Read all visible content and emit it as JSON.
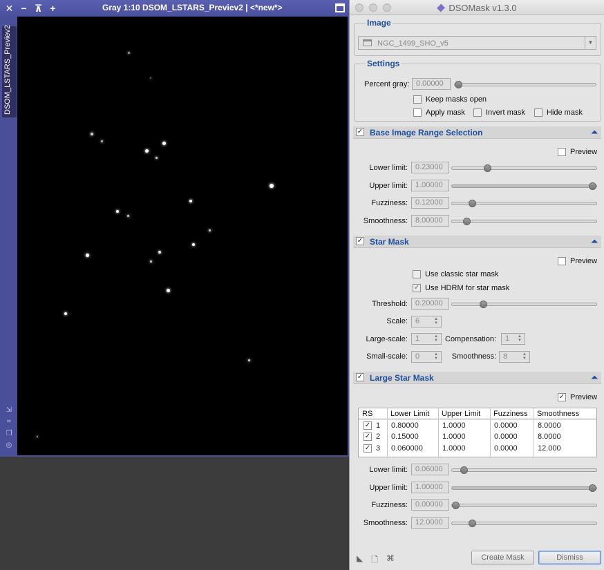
{
  "image_window": {
    "title": "Gray 1:10 DSOM_LSTARS_Previev2 | <*new*>",
    "side_tab": "DSOM_LSTARS_Previev2",
    "controls": [
      "✕",
      "−",
      "⊼",
      "+"
    ]
  },
  "dialog": {
    "title": "DSOMask v1.3.0",
    "image_group": {
      "title": "Image",
      "selected_image": "NGC_1499_SHO_v5"
    },
    "settings_group": {
      "title": "Settings",
      "percent_gray_label": "Percent gray:",
      "percent_gray_value": "0.00000",
      "percent_gray_level": 0.0,
      "keep_masks_open_label": "Keep masks open",
      "apply_mask_label": "Apply mask",
      "invert_mask_label": "Invert mask",
      "hide_mask_label": "Hide mask"
    },
    "base_range": {
      "title": "Base Image Range Selection",
      "checked": true,
      "preview_label": "Preview",
      "preview_checked": false,
      "rows": [
        {
          "label": "Lower limit:",
          "value": "0.23000",
          "level": 0.23
        },
        {
          "label": "Upper limit:",
          "value": "1.00000",
          "level": 1.0
        },
        {
          "label": "Fuzziness:",
          "value": "0.12000",
          "level": 0.12
        },
        {
          "label": "Smoothness:",
          "value": "8.00000",
          "level": 0.08
        }
      ]
    },
    "star_mask": {
      "title": "Star Mask",
      "checked": true,
      "preview_label": "Preview",
      "preview_checked": false,
      "use_classic_label": "Use classic star mask",
      "use_classic_checked": false,
      "use_hdrm_label": "Use HDRM for star mask",
      "use_hdrm_checked": true,
      "threshold_label": "Threshold:",
      "threshold_value": "0.20000",
      "threshold_level": 0.2,
      "scale_label": "Scale:",
      "scale_value": "6",
      "large_scale_label": "Large-scale:",
      "large_scale_value": "1",
      "compensation_label": "Compensation:",
      "compensation_value": "1",
      "small_scale_label": "Small-scale:",
      "small_scale_value": "0",
      "smoothness_label": "Smoothness:",
      "smoothness_value": "8"
    },
    "large_star_mask": {
      "title": "Large Star Mask",
      "checked": true,
      "preview_label": "Preview",
      "preview_checked": true,
      "table": {
        "columns": [
          "RS",
          "Lower Limit",
          "Upper Limit",
          "Fuzziness",
          "Smoothness"
        ],
        "rows": [
          {
            "checked": true,
            "rs": "1",
            "lower": "0.80000",
            "upper": "1.0000",
            "fuzz": "0.0000",
            "smooth": "8.0000"
          },
          {
            "checked": true,
            "rs": "2",
            "lower": "0.15000",
            "upper": "1.0000",
            "fuzz": "0.0000",
            "smooth": "8.0000"
          },
          {
            "checked": true,
            "rs": "3",
            "lower": "0.060000",
            "upper": "1.0000",
            "fuzz": "0.0000",
            "smooth": "12.000"
          }
        ]
      },
      "rows": [
        {
          "label": "Lower limit:",
          "value": "0.06000",
          "level": 0.06
        },
        {
          "label": "Upper limit:",
          "value": "1.00000",
          "level": 1.0
        },
        {
          "label": "Fuzziness:",
          "value": "0.00000",
          "level": 0.0
        },
        {
          "label": "Smoothness:",
          "value": "12.0000",
          "level": 0.12
        }
      ]
    },
    "buttons": {
      "create_mask": "Create Mask",
      "dismiss": "Dismiss"
    }
  }
}
